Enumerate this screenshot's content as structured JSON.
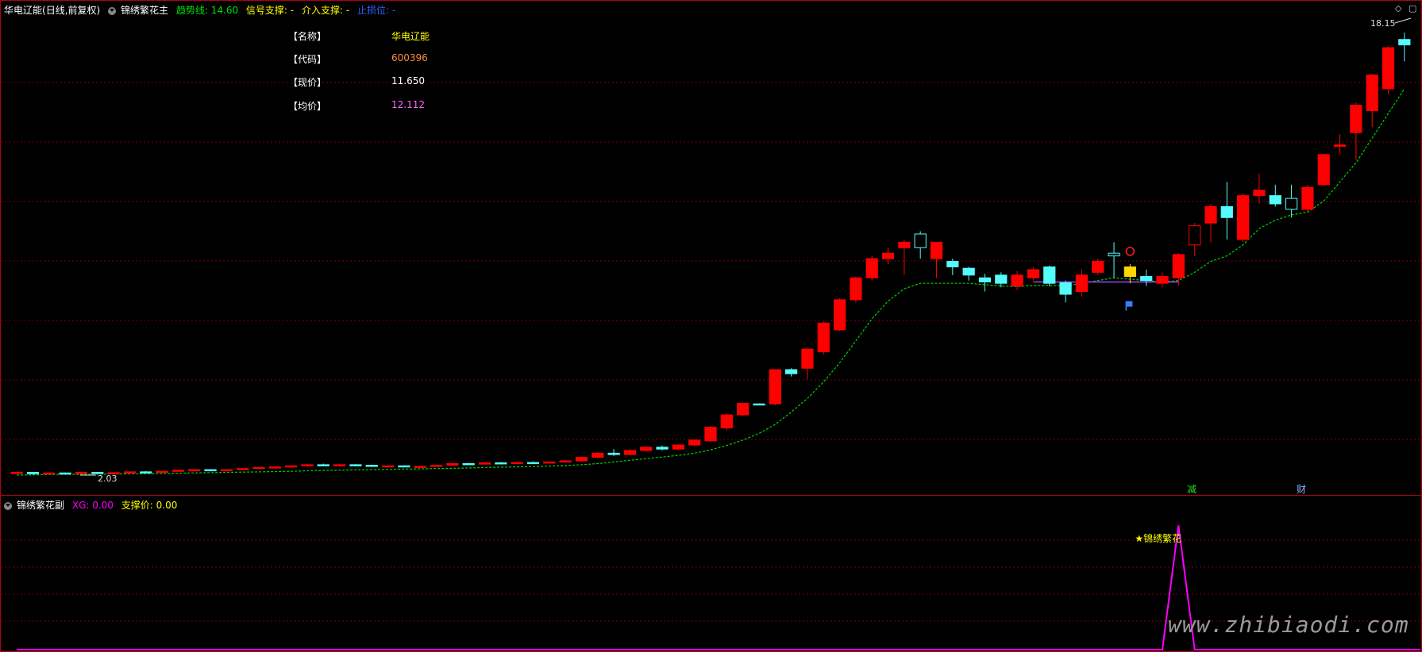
{
  "header": {
    "stock_name": "华电辽能",
    "period": "(日线,前复权)",
    "indicator": "锦绣繁花主",
    "trend_label": "趋势线: 14.60",
    "signal_label": "信号支撑: -",
    "entry_label": "介入支撑: -",
    "stop_label": "止损位: -"
  },
  "info_box": {
    "rows": [
      {
        "key": "【名称】",
        "value": "华电辽能",
        "color": "#ffff00"
      },
      {
        "key": "【代码】",
        "value": "600396",
        "color": "#ff8a3c"
      },
      {
        "key": "【现价】",
        "value": "11.650",
        "color": "#ffffff"
      },
      {
        "key": "【均价】",
        "value": "12.112",
        "color": "#ff66ff"
      }
    ]
  },
  "price_labels": {
    "high": "18.15",
    "low": "2.03"
  },
  "markers": {
    "m1": "减",
    "m2": "财"
  },
  "sub_header": {
    "indicator": "锦绣繁花副",
    "xg_label": "XG: 0.00",
    "support_label": "支撑价: 0.00"
  },
  "signal_label": "★锦绣繁花",
  "watermark": "www.zhibiaodi.com",
  "colors": {
    "up": "#ff0000",
    "down": "#54fcfc",
    "grid": "#7a0010",
    "ma": "#00d000",
    "signal": "#ff00ff",
    "highlight": "#ffd700"
  },
  "chart_data": {
    "type": "candlestick",
    "ylim": [
      2.0,
      18.5
    ],
    "candles": [
      [
        2.08,
        2.1,
        2.05,
        2.12
      ],
      [
        2.1,
        2.05,
        2.02,
        2.12
      ],
      [
        2.05,
        2.08,
        2.03,
        2.1
      ],
      [
        2.08,
        2.06,
        2.04,
        2.1
      ],
      [
        2.06,
        2.1,
        2.05,
        2.12
      ],
      [
        2.1,
        2.07,
        2.05,
        2.12
      ],
      [
        2.07,
        2.09,
        2.05,
        2.11
      ],
      [
        2.09,
        2.12,
        2.07,
        2.14
      ],
      [
        2.12,
        2.1,
        2.08,
        2.15
      ],
      [
        2.1,
        2.14,
        2.09,
        2.16
      ],
      [
        2.14,
        2.18,
        2.12,
        2.2
      ],
      [
        2.18,
        2.2,
        2.15,
        2.22
      ],
      [
        2.2,
        2.16,
        2.14,
        2.22
      ],
      [
        2.16,
        2.2,
        2.15,
        2.23
      ],
      [
        2.2,
        2.24,
        2.18,
        2.26
      ],
      [
        2.24,
        2.28,
        2.22,
        2.3
      ],
      [
        2.28,
        2.3,
        2.25,
        2.33
      ],
      [
        2.3,
        2.34,
        2.28,
        2.36
      ],
      [
        2.34,
        2.38,
        2.32,
        2.4
      ],
      [
        2.38,
        2.35,
        2.33,
        2.42
      ],
      [
        2.35,
        2.38,
        2.33,
        2.4
      ],
      [
        2.38,
        2.36,
        2.34,
        2.4
      ],
      [
        2.36,
        2.32,
        2.3,
        2.38
      ],
      [
        2.32,
        2.34,
        2.3,
        2.36
      ],
      [
        2.34,
        2.3,
        2.28,
        2.36
      ],
      [
        2.3,
        2.32,
        2.28,
        2.35
      ],
      [
        2.32,
        2.36,
        2.3,
        2.38
      ],
      [
        2.36,
        2.42,
        2.34,
        2.44
      ],
      [
        2.42,
        2.4,
        2.38,
        2.45
      ],
      [
        2.4,
        2.45,
        2.38,
        2.48
      ],
      [
        2.45,
        2.42,
        2.4,
        2.48
      ],
      [
        2.42,
        2.46,
        2.4,
        2.48
      ],
      [
        2.46,
        2.44,
        2.42,
        2.5
      ],
      [
        2.44,
        2.48,
        2.42,
        2.5
      ],
      [
        2.48,
        2.52,
        2.45,
        2.55
      ],
      [
        2.52,
        2.65,
        2.5,
        2.68
      ],
      [
        2.65,
        2.8,
        2.62,
        2.84
      ],
      [
        2.8,
        2.75,
        2.7,
        2.95
      ],
      [
        2.75,
        2.9,
        2.72,
        2.95
      ],
      [
        2.9,
        3.02,
        2.85,
        3.05
      ],
      [
        3.02,
        2.95,
        2.9,
        3.08
      ],
      [
        2.95,
        3.1,
        2.92,
        3.12
      ],
      [
        3.1,
        3.28,
        3.05,
        3.3
      ],
      [
        3.25,
        3.75,
        3.2,
        3.8
      ],
      [
        3.72,
        4.2,
        3.65,
        4.25
      ],
      [
        4.2,
        4.62,
        4.15,
        4.65
      ],
      [
        4.6,
        4.58,
        4.55,
        4.62
      ],
      [
        4.6,
        5.85,
        4.55,
        5.85
      ],
      [
        5.85,
        5.7,
        5.6,
        5.9
      ],
      [
        5.9,
        6.6,
        5.5,
        6.65
      ],
      [
        6.5,
        7.55,
        6.4,
        7.6
      ],
      [
        7.3,
        8.4,
        7.25,
        8.45
      ],
      [
        8.4,
        9.2,
        8.3,
        9.25
      ],
      [
        9.2,
        9.9,
        9.1,
        10.0
      ],
      [
        9.9,
        10.1,
        9.7,
        10.3
      ],
      [
        10.3,
        10.5,
        9.3,
        10.6
      ],
      [
        10.8,
        10.3,
        9.9,
        10.9
      ],
      [
        9.9,
        10.5,
        9.2,
        10.5
      ],
      [
        9.8,
        9.6,
        9.3,
        9.9
      ],
      [
        9.55,
        9.3,
        9.1,
        9.6
      ],
      [
        9.2,
        9.05,
        8.7,
        9.35
      ],
      [
        9.3,
        9.0,
        8.85,
        9.4
      ],
      [
        8.9,
        9.3,
        8.75,
        9.45
      ],
      [
        9.2,
        9.5,
        9.1,
        9.6
      ],
      [
        9.6,
        9.0,
        8.9,
        9.65
      ],
      [
        9.02,
        8.6,
        8.3,
        9.1
      ],
      [
        8.7,
        9.3,
        8.5,
        9.5
      ],
      [
        9.4,
        9.8,
        9.3,
        9.9
      ],
      [
        10.1,
        10.0,
        9.2,
        10.5
      ],
      [
        9.6,
        9.25,
        9.0,
        9.7
      ],
      [
        9.25,
        9.1,
        8.9,
        9.5
      ],
      [
        9.0,
        9.25,
        8.85,
        9.4
      ],
      [
        9.2,
        10.05,
        8.9,
        10.1
      ],
      [
        10.4,
        11.1,
        10.0,
        11.2
      ],
      [
        11.2,
        11.8,
        10.5,
        11.9
      ],
      [
        11.8,
        11.4,
        10.6,
        12.7
      ],
      [
        10.6,
        12.2,
        10.5,
        12.3
      ],
      [
        12.2,
        12.4,
        11.9,
        13.0
      ],
      [
        12.2,
        11.9,
        11.8,
        12.6
      ],
      [
        12.1,
        11.7,
        11.4,
        12.6
      ],
      [
        11.7,
        12.5,
        11.6,
        12.6
      ],
      [
        12.6,
        13.7,
        12.55,
        13.75
      ],
      [
        14.0,
        14.05,
        13.7,
        14.45
      ],
      [
        14.5,
        15.5,
        13.5,
        15.6
      ],
      [
        15.3,
        16.6,
        14.7,
        16.65
      ],
      [
        16.1,
        17.6,
        15.9,
        17.65
      ],
      [
        17.9,
        17.7,
        17.1,
        18.15
      ]
    ],
    "ma": [
      2.0,
      2.01,
      2.02,
      2.03,
      2.03,
      2.04,
      2.04,
      2.05,
      2.05,
      2.06,
      2.07,
      2.08,
      2.09,
      2.1,
      2.11,
      2.12,
      2.13,
      2.14,
      2.16,
      2.17,
      2.18,
      2.19,
      2.2,
      2.21,
      2.22,
      2.23,
      2.24,
      2.25,
      2.26,
      2.28,
      2.29,
      2.3,
      2.31,
      2.33,
      2.35,
      2.38,
      2.42,
      2.48,
      2.54,
      2.6,
      2.66,
      2.72,
      2.8,
      2.92,
      3.08,
      3.28,
      3.52,
      3.85,
      4.3,
      4.8,
      5.4,
      6.1,
      6.9,
      7.7,
      8.35,
      8.8,
      9.0,
      9.0,
      9.0,
      9.0,
      8.95,
      8.9,
      8.88,
      8.92,
      8.92,
      8.9,
      9.0,
      9.1,
      9.2,
      9.15,
      9.1,
      9.05,
      9.1,
      9.4,
      9.8,
      10.0,
      10.4,
      11.0,
      11.3,
      11.5,
      11.6,
      12.0,
      12.7,
      13.4,
      14.3,
      15.2,
      16.1
    ],
    "sub_series": {
      "ylim": [
        0,
        5
      ],
      "values": [
        0,
        0,
        0,
        0,
        0,
        0,
        0,
        0,
        0,
        0,
        0,
        0,
        0,
        0,
        0,
        0,
        0,
        0,
        0,
        0,
        0,
        0,
        0,
        0,
        0,
        0,
        0,
        0,
        0,
        0,
        0,
        0,
        0,
        0,
        0,
        0,
        0,
        0,
        0,
        0,
        0,
        0,
        0,
        0,
        0,
        0,
        0,
        0,
        0,
        0,
        0,
        0,
        0,
        0,
        0,
        0,
        0,
        0,
        0,
        0,
        0,
        0,
        0,
        0,
        0,
        0,
        0,
        0,
        0,
        0,
        0,
        0,
        4.5,
        0,
        0,
        0,
        0,
        0,
        0,
        0,
        0,
        0,
        0,
        0,
        0,
        0,
        0,
        0
      ]
    }
  }
}
